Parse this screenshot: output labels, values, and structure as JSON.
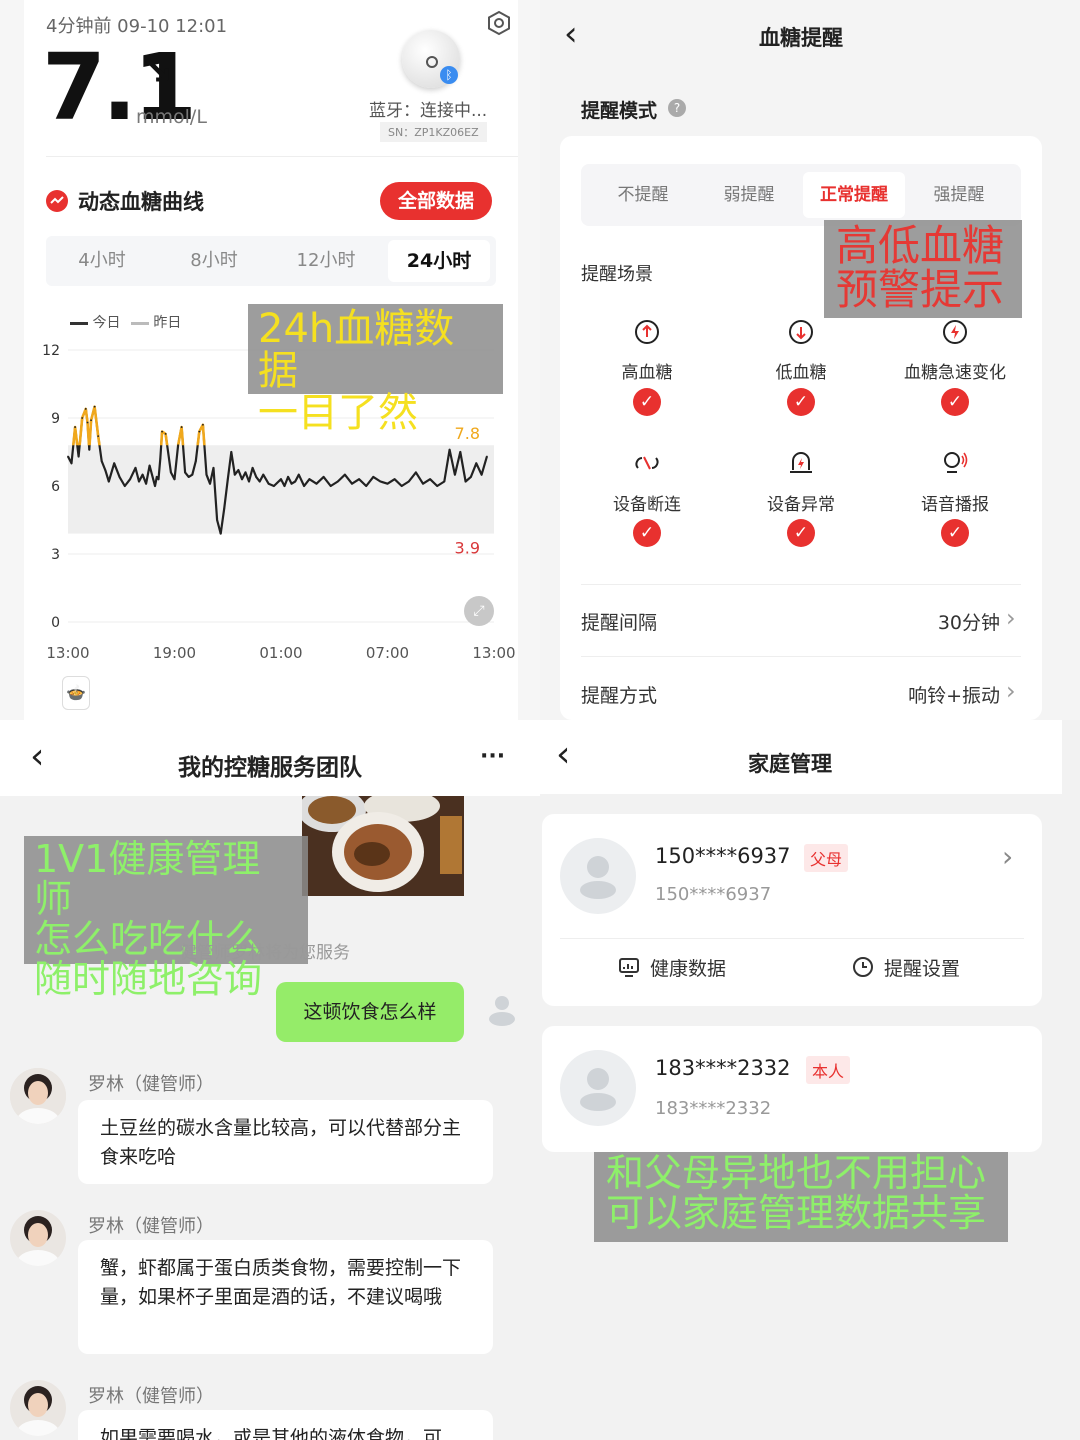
{
  "glucose": {
    "timestamp": "4分钟前 09-10 12:01",
    "value": "7.1",
    "trend_arrow": "↘",
    "unit": "mmol/L",
    "bluetooth_status": "蓝牙：连接中...",
    "serial": "SN：ZP1KZ06EZ",
    "section_title": "动态血糖曲线",
    "all_data_button": "全部数据",
    "range_tabs": [
      "4小时",
      "8小时",
      "12小时",
      "24小时"
    ],
    "active_tab": "24小时",
    "legend_today": "今日",
    "legend_yesterday": "昨日",
    "overlay_line1": "24h血糖数据",
    "overlay_line2": "一目了然"
  },
  "chart_data": {
    "type": "line",
    "xlabel": "",
    "ylabel": "",
    "y_ticks": [
      "12",
      "9",
      "6",
      "3",
      "0"
    ],
    "x_ticks": [
      "13:00",
      "19:00",
      "01:00",
      "07:00",
      "13:00"
    ],
    "ylim": [
      0,
      12
    ],
    "target_range": [
      3.9,
      7.8
    ],
    "high_threshold_label": "7.8",
    "low_threshold_label": "3.9",
    "high_color": "#f0a81c",
    "low_color": "#d9383a",
    "line_color": "#222222",
    "series": [
      {
        "name": "今日",
        "x": [
          0,
          0.2,
          0.4,
          0.6,
          0.8,
          1.0,
          1.1,
          1.2,
          1.3,
          1.5,
          1.7,
          1.9,
          2.1,
          2.3,
          2.6,
          2.9,
          3.2,
          3.5,
          3.8,
          4.0,
          4.2,
          4.4,
          4.6,
          4.8,
          4.9,
          5.0,
          5.1,
          5.2,
          5.3,
          5.5,
          5.8,
          6.0,
          6.2,
          6.4,
          6.6,
          6.8,
          7.0,
          7.2,
          7.4,
          7.6,
          7.8,
          8.0,
          8.2,
          8.4,
          8.6,
          8.8,
          9.0,
          9.2,
          9.4,
          9.6,
          9.8,
          10.0,
          10.2,
          10.4,
          10.6,
          10.8,
          11.0,
          11.3,
          11.6,
          12.0,
          12.2,
          12.4,
          12.6,
          12.8,
          13.0,
          13.3,
          13.6,
          14.0,
          14.4,
          14.8,
          15.2,
          15.6,
          16.0,
          16.4,
          16.8,
          17.2,
          17.6,
          18.0,
          18.4,
          18.8,
          19.2,
          19.6,
          20.0,
          20.4,
          20.8,
          21.2,
          21.5,
          21.8,
          22.1,
          22.4,
          22.7,
          23.0,
          23.3,
          23.6
        ],
        "values": [
          7.3,
          7.0,
          8.6,
          7.3,
          9.0,
          9.4,
          8.8,
          7.6,
          8.9,
          9.5,
          8.2,
          7.1,
          6.7,
          6.2,
          7.0,
          6.4,
          6.0,
          6.3,
          6.8,
          6.2,
          6.5,
          6.1,
          6.9,
          6.3,
          6.0,
          6.4,
          6.3,
          7.2,
          8.4,
          8.3,
          6.6,
          6.3,
          7.8,
          8.6,
          6.6,
          6.4,
          6.5,
          7.1,
          8.4,
          8.7,
          6.5,
          6.1,
          6.8,
          4.5,
          3.9,
          5.0,
          6.3,
          7.5,
          6.5,
          6.7,
          6.3,
          6.6,
          6.2,
          6.8,
          6.4,
          6.2,
          6.5,
          6.1,
          6.0,
          6.3,
          6.0,
          6.4,
          6.1,
          6.2,
          6.5,
          6.0,
          6.3,
          6.1,
          6.4,
          6.0,
          6.2,
          6.5,
          6.1,
          6.3,
          6.0,
          6.4,
          6.2,
          6.1,
          6.3,
          6.0,
          6.2,
          6.6,
          6.1,
          6.3,
          6.0,
          6.2,
          7.6,
          6.5,
          7.5,
          6.2,
          6.4,
          7.0,
          6.5,
          7.3
        ]
      }
    ]
  },
  "reminder": {
    "title": "血糖提醒",
    "mode_label": "提醒模式",
    "modes": [
      "不提醒",
      "弱提醒",
      "正常提醒",
      "强提醒"
    ],
    "active_mode": "正常提醒",
    "scene_label": "提醒场景",
    "overlay_line1": "高低血糖",
    "overlay_line2": "预警提示",
    "scenes": [
      {
        "label": "高血糖",
        "icon": "arrow-up-icon",
        "checked": "✓"
      },
      {
        "label": "低血糖",
        "icon": "arrow-down-icon",
        "checked": "✓"
      },
      {
        "label": "血糖急速变化",
        "icon": "lightning-icon",
        "checked": "✓"
      },
      {
        "label": "设备断连",
        "icon": "broken-link-icon",
        "checked": "✓"
      },
      {
        "label": "设备异常",
        "icon": "device-alert-icon",
        "checked": "✓"
      },
      {
        "label": "语音播报",
        "icon": "voice-icon",
        "checked": "✓"
      }
    ],
    "interval_label": "提醒间隔",
    "interval_value": "30分钟",
    "method_label": "提醒方式",
    "method_value": "响铃+振动"
  },
  "team": {
    "title": "我的控糖服务团队",
    "more": "···",
    "overlay_line1": "1V1健康管理师",
    "overlay_line2": "怎么吃吃什么",
    "overlay_line3": "随时随地咨询",
    "system_notice": "健管师罗林将为您服务",
    "user_message": "这顿饮食怎么样",
    "messages": [
      {
        "sender": "罗林（健管师）",
        "text": "土豆丝的碳水含量比较高，可以代替部分主食来吃哈"
      },
      {
        "sender": "罗林（健管师）",
        "text": "蟹，虾都属于蛋白质类食物，需要控制一下量，如果杯子里面是酒的话，不建议喝哦"
      },
      {
        "sender": "罗林（健管师）",
        "text": "如果需要喝水，或是其他的液体食物，可"
      }
    ]
  },
  "family": {
    "title": "家庭管理",
    "members": [
      {
        "phone": "150****6937",
        "sub": "150****6937",
        "tag": "父母"
      },
      {
        "phone": "183****2332",
        "sub": "183****2332",
        "tag": "本人"
      }
    ],
    "health_data": "健康数据",
    "reminder_settings": "提醒设置",
    "overlay_line1": "和父母异地也不用担心",
    "overlay_line2": "可以家庭管理数据共享"
  },
  "colors": {
    "accent_red": "#e8312f",
    "overlay_yellow": "#f5e020",
    "overlay_red": "#e53935",
    "overlay_green": "#8ef06a",
    "chat_green": "#95ec69"
  }
}
